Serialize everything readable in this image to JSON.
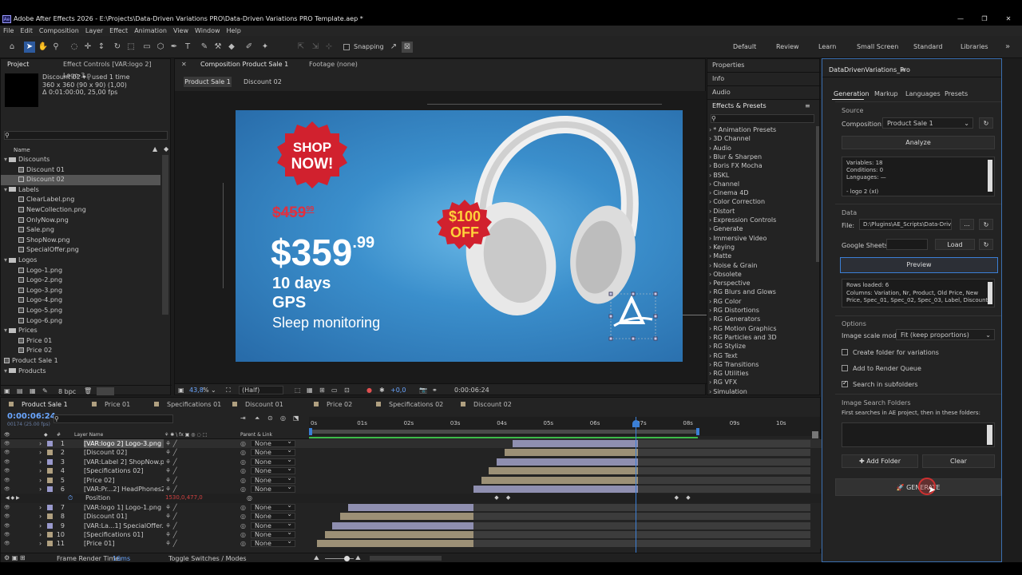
{
  "app": {
    "title": "Adobe After Effects 2026 - E:\\Projects\\Data-Driven Variations PRO\\Data-Driven Variations PRO Template.aep *",
    "logo": "Ae"
  },
  "menu": [
    "File",
    "Edit",
    "Composition",
    "Layer",
    "Effect",
    "Animation",
    "View",
    "Window",
    "Help"
  ],
  "toolbar": {
    "snapping": "Snapping",
    "workspaces": [
      "Default",
      "Review",
      "Learn",
      "Small Screen",
      "Standard",
      "Libraries"
    ]
  },
  "project": {
    "tabs": [
      "Project",
      "Effect Controls [VAR:logo 2] Logo-3.p"
    ],
    "info": [
      "Discount 02 ▾ , used 1 time",
      "360 x 360  (90 x 90) (1,00)",
      "Δ 0:01:00:00, 25,00 fps"
    ],
    "search_placeholder": "",
    "name_header": "Name",
    "items": [
      {
        "label": "Discounts",
        "type": "folder",
        "open": true,
        "indent": 0
      },
      {
        "label": "Discount 01",
        "type": "comp",
        "indent": 1
      },
      {
        "label": "Discount 02",
        "type": "comp",
        "indent": 1,
        "selected": true
      },
      {
        "label": "Labels",
        "type": "folder",
        "open": true,
        "indent": 0
      },
      {
        "label": "ClearLabel.png",
        "type": "file",
        "indent": 1
      },
      {
        "label": "NewCollection.png",
        "type": "file",
        "indent": 1
      },
      {
        "label": "OnlyNow.png",
        "type": "file",
        "indent": 1
      },
      {
        "label": "Sale.png",
        "type": "file",
        "indent": 1
      },
      {
        "label": "ShopNow.png",
        "type": "file",
        "indent": 1
      },
      {
        "label": "SpecialOffer.png",
        "type": "file",
        "indent": 1
      },
      {
        "label": "Logos",
        "type": "folder",
        "open": true,
        "indent": 0
      },
      {
        "label": "Logo-1.png",
        "type": "file",
        "indent": 1
      },
      {
        "label": "Logo-2.png",
        "type": "file",
        "indent": 1
      },
      {
        "label": "Logo-3.png",
        "type": "file",
        "indent": 1
      },
      {
        "label": "Logo-4.png",
        "type": "file",
        "indent": 1
      },
      {
        "label": "Logo-5.png",
        "type": "file",
        "indent": 1
      },
      {
        "label": "Logo-6.png",
        "type": "file",
        "indent": 1
      },
      {
        "label": "Prices",
        "type": "folder",
        "open": true,
        "indent": 0
      },
      {
        "label": "Price 01",
        "type": "comp",
        "indent": 1
      },
      {
        "label": "Price 02",
        "type": "comp",
        "indent": 1
      },
      {
        "label": "Product Sale 1",
        "type": "comp",
        "indent": 0
      },
      {
        "label": "Products",
        "type": "folder",
        "open": true,
        "indent": 0
      }
    ],
    "bpc": "8 bpc"
  },
  "composition": {
    "tabs": [
      "Composition Product Sale 1",
      "Footage (none)"
    ],
    "breadcrumbs": [
      "Product Sale 1",
      "Discount 02"
    ],
    "zoom": "43,8",
    "zoom_unit": "%",
    "resolution": "(Half)",
    "exposure": "+0,0",
    "timecode": "0:00:06:24"
  },
  "ad": {
    "badge_line1": "SHOP",
    "badge_line2": "NOW!",
    "old_price": "$459",
    "old_price_cents": "99",
    "new_price": "$359",
    "new_price_cents": ".99",
    "discount_line1": "$100",
    "discount_line2": "OFF",
    "spec1": "10 days",
    "spec2": "GPS",
    "spec3": "Sleep monitoring"
  },
  "right_panels": {
    "properties": "Properties",
    "info": "Info",
    "audio": "Audio",
    "effects_title": "Effects & Presets"
  },
  "effects": [
    "* Animation Presets",
    "3D Channel",
    "Audio",
    "Blur & Sharpen",
    "Boris FX Mocha",
    "BSKL",
    "Channel",
    "Cinema 4D",
    "Color Correction",
    "Distort",
    "Expression Controls",
    "Generate",
    "Immersive Video",
    "Keying",
    "Matte",
    "Noise & Grain",
    "Obsolete",
    "Perspective",
    "RG Blurs and Glows",
    "RG Color",
    "RG Distortions",
    "RG Generators",
    "RG Motion Graphics",
    "RG Particles and 3D",
    "RG Stylize",
    "RG Text",
    "RG Transitions",
    "RG Utilities",
    "RG VFX",
    "Simulation"
  ],
  "plugin": {
    "title": "DataDrivenVariations_Pro",
    "tabs": [
      "Generation",
      "Markup",
      "Languages",
      "Presets"
    ],
    "source_label": "Source",
    "composition_label": "Composition:",
    "composition_value": "Product Sale 1",
    "analyze": "Analyze",
    "analysis": [
      "Variables: 18",
      "Conditions: 0",
      "Languages: —",
      "",
      "- logo 2 (xI)"
    ],
    "data_label": "Data",
    "file_label": "File:",
    "file_value": "D:\\Plugins\\AE_Scripts\\Data-Drive",
    "browse": "...",
    "sheets_label": "Google Sheets:",
    "load": "Load",
    "preview": "Preview",
    "rows_info": [
      "Rows loaded: 6",
      "Columns: Variation, Nr, Product, Old Price, New",
      "Price, Spec_01, Spec_02, Spec_03, Label, Discount,"
    ],
    "options_label": "Options",
    "scale_label": "Image scale mode:",
    "scale_value": "Fit (keep proportions)",
    "opt1": "Create folder for variations",
    "opt2": "Add to Render Queue",
    "opt3": "Search in subfolders",
    "folders_label": "Image Search Folders",
    "folders_hint": "First searches in AE project, then in these folders:",
    "add_folder": "Add Folder",
    "clear": "Clear",
    "generate": "GENERATE"
  },
  "timeline": {
    "tabs": [
      "Product Sale 1",
      "Price 01",
      "Specifications 01",
      "Discount 01",
      "Price 02",
      "Specifications 02",
      "Discount 02"
    ],
    "timecode": "0:00:06:24",
    "frames": "00174 (25.00 fps)",
    "col_layer": "Layer Name",
    "col_parent": "Parent & Link",
    "ruler": [
      "0s",
      "01s",
      "02s",
      "03s",
      "04s",
      "05s",
      "06s",
      "07s",
      "08s",
      "09s",
      "10s"
    ],
    "position_label": "Position",
    "position_value": "1530,0,477,0",
    "parent_none": "None",
    "layers": [
      {
        "num": "1",
        "name": "[VAR:logo 2] Logo-3.png",
        "color": "#9999cc",
        "start": 0.52,
        "end": 0.84,
        "barcolor": "#8f8fb0",
        "selected": true
      },
      {
        "num": "2",
        "name": "[Discount 02]",
        "color": "#b0a080",
        "start": 0.5,
        "end": 0.84,
        "barcolor": "#9c9076"
      },
      {
        "num": "3",
        "name": "[VAR:Label 2] ShopNow.png",
        "color": "#9999cc",
        "start": 0.48,
        "end": 0.84,
        "barcolor": "#8f8fb0"
      },
      {
        "num": "4",
        "name": "[Specifications 02]",
        "color": "#b0a080",
        "start": 0.46,
        "end": 0.84,
        "barcolor": "#9c9076"
      },
      {
        "num": "5",
        "name": "[Price 02]",
        "color": "#b0a080",
        "start": 0.44,
        "end": 0.84,
        "barcolor": "#9c9076"
      },
      {
        "num": "6",
        "name": "[VAR:Pr...2] HeadPhones2.psd",
        "color": "#9999cc",
        "start": 0.42,
        "end": 0.84,
        "barcolor": "#8f8fb0"
      },
      {
        "num": "7",
        "name": "[VAR:logo 1] Logo-1.png",
        "color": "#9999cc",
        "start": 0.1,
        "end": 0.42,
        "barcolor": "#8f8fb0"
      },
      {
        "num": "8",
        "name": "[Discount 01]",
        "color": "#b0a080",
        "start": 0.08,
        "end": 0.42,
        "barcolor": "#9c9076"
      },
      {
        "num": "9",
        "name": "[VAR:La...1] SpecialOffer.png",
        "color": "#9999cc",
        "start": 0.06,
        "end": 0.42,
        "barcolor": "#8f8fb0"
      },
      {
        "num": "10",
        "name": "[Specifications 01]",
        "color": "#b0a080",
        "start": 0.04,
        "end": 0.42,
        "barcolor": "#9c9076"
      },
      {
        "num": "11",
        "name": "[Price 01]",
        "color": "#b0a080",
        "start": 0.02,
        "end": 0.42,
        "barcolor": "#9c9076"
      }
    ],
    "frame_render": "Frame Render Time:",
    "frame_render_value": "16ms",
    "toggle": "Toggle Switches / Modes"
  }
}
